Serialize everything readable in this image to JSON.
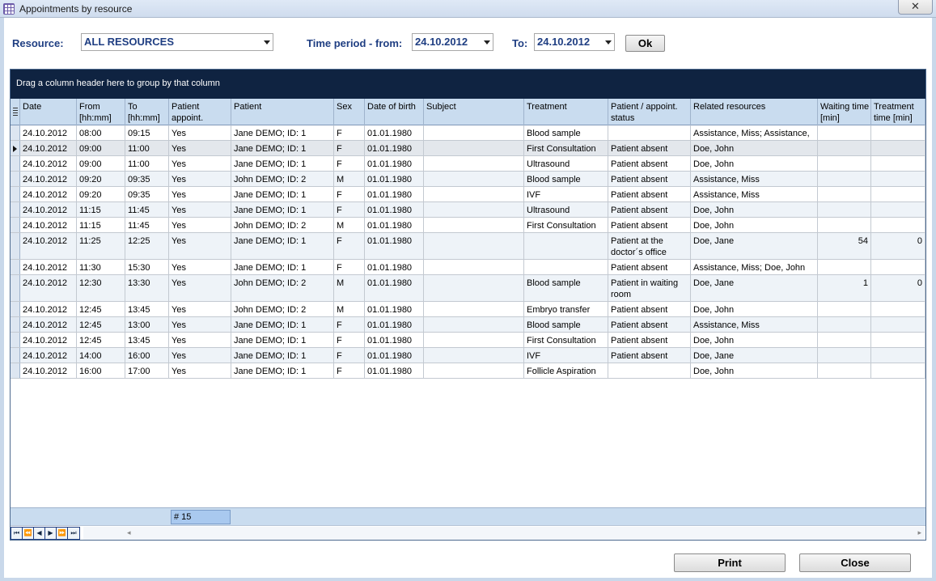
{
  "window": {
    "title": "Appointments by resource",
    "close_glyph": "✕"
  },
  "toolbar": {
    "resource_label": "Resource:",
    "resource_value": "ALL RESOURCES",
    "period_from_label": "Time period - from:",
    "from_value": "24.10.2012",
    "to_label": "To:",
    "to_value": "24.10.2012",
    "ok_label": "Ok"
  },
  "grid": {
    "group_hint": "Drag a column header here to group by that column",
    "columns": [
      {
        "key": "date",
        "label": "Date"
      },
      {
        "key": "from",
        "label": "From [hh:mm]"
      },
      {
        "key": "to",
        "label": "To [hh:mm]"
      },
      {
        "key": "patient_appoint",
        "label": "Patient appoint."
      },
      {
        "key": "patient",
        "label": "Patient"
      },
      {
        "key": "sex",
        "label": "Sex"
      },
      {
        "key": "dob",
        "label": "Date of birth"
      },
      {
        "key": "subject",
        "label": "Subject"
      },
      {
        "key": "treatment",
        "label": "Treatment"
      },
      {
        "key": "status",
        "label": "Patient / appoint. status"
      },
      {
        "key": "resources",
        "label": "Related resources"
      },
      {
        "key": "waiting",
        "label": "Waiting time [min]"
      },
      {
        "key": "treatment_time",
        "label": "Treatment time [min]"
      }
    ],
    "rows": [
      {
        "date": "24.10.2012",
        "from": "08:00",
        "to": "09:15",
        "patient_appoint": "Yes",
        "patient": "Jane DEMO; ID: 1",
        "sex": "F",
        "dob": "01.01.1980",
        "subject": "",
        "treatment": "Blood sample",
        "status": "",
        "resources": "Assistance, Miss; Assistance, Miss",
        "waiting": "",
        "treatment_time": ""
      },
      {
        "date": "24.10.2012",
        "from": "09:00",
        "to": "11:00",
        "patient_appoint": "Yes",
        "patient": "Jane DEMO; ID: 1",
        "sex": "F",
        "dob": "01.01.1980",
        "subject": "",
        "treatment": "First Consultation",
        "status": "Patient absent",
        "resources": "Doe, John",
        "waiting": "",
        "treatment_time": ""
      },
      {
        "date": "24.10.2012",
        "from": "09:00",
        "to": "11:00",
        "patient_appoint": "Yes",
        "patient": "Jane DEMO; ID: 1",
        "sex": "F",
        "dob": "01.01.1980",
        "subject": "",
        "treatment": "Ultrasound",
        "status": "Patient absent",
        "resources": "Doe, John",
        "waiting": "",
        "treatment_time": ""
      },
      {
        "date": "24.10.2012",
        "from": "09:20",
        "to": "09:35",
        "patient_appoint": "Yes",
        "patient": "John DEMO; ID: 2",
        "sex": "M",
        "dob": "01.01.1980",
        "subject": "",
        "treatment": "Blood sample",
        "status": "Patient absent",
        "resources": "Assistance, Miss",
        "waiting": "",
        "treatment_time": ""
      },
      {
        "date": "24.10.2012",
        "from": "09:20",
        "to": "09:35",
        "patient_appoint": "Yes",
        "patient": "Jane DEMO; ID: 1",
        "sex": "F",
        "dob": "01.01.1980",
        "subject": "",
        "treatment": "IVF",
        "status": "Patient absent",
        "resources": "Assistance, Miss",
        "waiting": "",
        "treatment_time": ""
      },
      {
        "date": "24.10.2012",
        "from": "11:15",
        "to": "11:45",
        "patient_appoint": "Yes",
        "patient": "Jane DEMO; ID: 1",
        "sex": "F",
        "dob": "01.01.1980",
        "subject": "",
        "treatment": "Ultrasound",
        "status": "Patient absent",
        "resources": "Doe, John",
        "waiting": "",
        "treatment_time": ""
      },
      {
        "date": "24.10.2012",
        "from": "11:15",
        "to": "11:45",
        "patient_appoint": "Yes",
        "patient": "John DEMO; ID: 2",
        "sex": "M",
        "dob": "01.01.1980",
        "subject": "",
        "treatment": "First Consultation",
        "status": "Patient absent",
        "resources": "Doe, John",
        "waiting": "",
        "treatment_time": ""
      },
      {
        "date": "24.10.2012",
        "from": "11:25",
        "to": "12:25",
        "patient_appoint": "Yes",
        "patient": "Jane DEMO; ID: 1",
        "sex": "F",
        "dob": "01.01.1980",
        "subject": "",
        "treatment": "",
        "status": "Patient at the doctor´s office",
        "resources": "Doe, Jane",
        "waiting": "54",
        "treatment_time": "0"
      },
      {
        "date": "24.10.2012",
        "from": "11:30",
        "to": "15:30",
        "patient_appoint": "Yes",
        "patient": "Jane DEMO; ID: 1",
        "sex": "F",
        "dob": "01.01.1980",
        "subject": "",
        "treatment": "",
        "status": "Patient absent",
        "resources": "Assistance, Miss; Doe, John",
        "waiting": "",
        "treatment_time": ""
      },
      {
        "date": "24.10.2012",
        "from": "12:30",
        "to": "13:30",
        "patient_appoint": "Yes",
        "patient": "John DEMO; ID: 2",
        "sex": "M",
        "dob": "01.01.1980",
        "subject": "",
        "treatment": "Blood sample",
        "status": "Patient in waiting room",
        "resources": "Doe, Jane",
        "waiting": "1",
        "treatment_time": "0"
      },
      {
        "date": "24.10.2012",
        "from": "12:45",
        "to": "13:45",
        "patient_appoint": "Yes",
        "patient": "John DEMO; ID: 2",
        "sex": "M",
        "dob": "01.01.1980",
        "subject": "",
        "treatment": "Embryo transfer",
        "status": "Patient absent",
        "resources": "Doe, John",
        "waiting": "",
        "treatment_time": ""
      },
      {
        "date": "24.10.2012",
        "from": "12:45",
        "to": "13:00",
        "patient_appoint": "Yes",
        "patient": "Jane DEMO; ID: 1",
        "sex": "F",
        "dob": "01.01.1980",
        "subject": "",
        "treatment": "Blood sample",
        "status": "Patient absent",
        "resources": "Assistance, Miss",
        "waiting": "",
        "treatment_time": ""
      },
      {
        "date": "24.10.2012",
        "from": "12:45",
        "to": "13:45",
        "patient_appoint": "Yes",
        "patient": "Jane DEMO; ID: 1",
        "sex": "F",
        "dob": "01.01.1980",
        "subject": "",
        "treatment": "First Consultation",
        "status": "Patient absent",
        "resources": "Doe, John",
        "waiting": "",
        "treatment_time": ""
      },
      {
        "date": "24.10.2012",
        "from": "14:00",
        "to": "16:00",
        "patient_appoint": "Yes",
        "patient": "Jane DEMO; ID: 1",
        "sex": "F",
        "dob": "01.01.1980",
        "subject": "",
        "treatment": "IVF",
        "status": "Patient absent",
        "resources": "Doe, Jane",
        "waiting": "",
        "treatment_time": ""
      },
      {
        "date": "24.10.2012",
        "from": "16:00",
        "to": "17:00",
        "patient_appoint": "Yes",
        "patient": "Jane DEMO; ID: 1",
        "sex": "F",
        "dob": "01.01.1980",
        "subject": "",
        "treatment": "Follicle Aspiration",
        "status": "",
        "resources": "Doe, John",
        "waiting": "",
        "treatment_time": ""
      }
    ],
    "record_count": "# 15",
    "nav": [
      "⏮",
      "⏪",
      "◀",
      "▶",
      "⏩",
      "⏭"
    ],
    "scroll_left_glyph": "◂",
    "scroll_right_glyph": "▸"
  },
  "buttons": {
    "print_label": "Print",
    "close_label": "Close"
  }
}
